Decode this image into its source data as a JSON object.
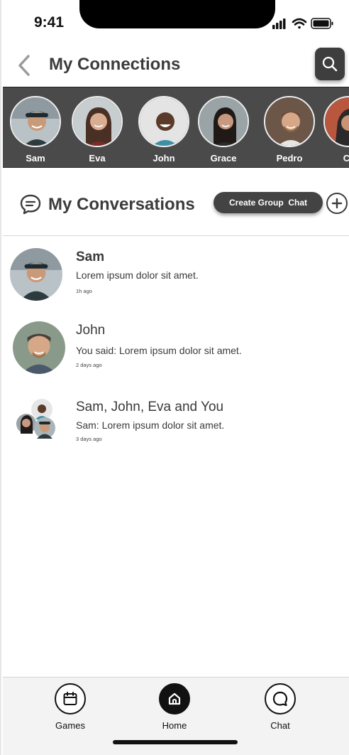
{
  "status_bar": {
    "time": "9:41"
  },
  "header": {
    "title": "My Connections"
  },
  "connections": [
    {
      "name": "Sam"
    },
    {
      "name": "Eva"
    },
    {
      "name": "John"
    },
    {
      "name": "Grace"
    },
    {
      "name": "Pedro"
    },
    {
      "name": "Ca"
    }
  ],
  "conversations_section": {
    "title": "My Conversations",
    "create_group_label": "Create Group  Chat"
  },
  "conversations": [
    {
      "name": "Sam",
      "message": "Lorem ipsum dolor sit amet.",
      "time": "1h ago"
    },
    {
      "name": "John",
      "message": "You said: Lorem ipsum dolor sit amet.",
      "time": "2 days ago"
    },
    {
      "name": "Sam, John, Eva and You",
      "message": "Sam: Lorem ipsum dolor sit amet.",
      "time": "3 days ago"
    }
  ],
  "tabbar": {
    "tabs": [
      {
        "label": "Games",
        "icon": "calendar-icon"
      },
      {
        "label": "Home",
        "icon": "home-icon",
        "active": true
      },
      {
        "label": "Chat",
        "icon": "chat-icon"
      }
    ]
  }
}
